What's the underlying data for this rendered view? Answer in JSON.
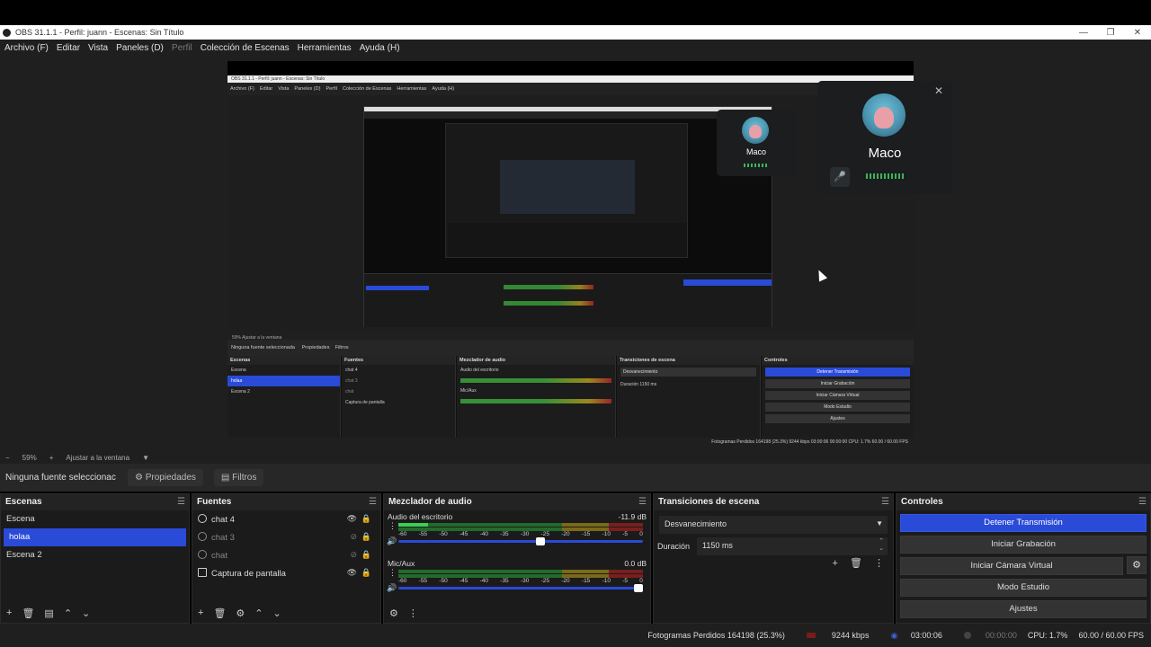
{
  "window": {
    "title": "OBS 31.1.1 - Perfil: juann - Escenas: Sin Título",
    "controls": [
      "—",
      "❐",
      "✕"
    ]
  },
  "menu": [
    {
      "label": "Archivo (F)",
      "enabled": true
    },
    {
      "label": "Editar",
      "enabled": true
    },
    {
      "label": "Vista",
      "enabled": true
    },
    {
      "label": "Paneles (D)",
      "enabled": true
    },
    {
      "label": "Perfil",
      "enabled": false
    },
    {
      "label": "Colección de Escenas",
      "enabled": true
    },
    {
      "label": "Herramientas",
      "enabled": true
    },
    {
      "label": "Ayuda (H)",
      "enabled": true
    }
  ],
  "preview": {
    "inner_menu": [
      "Archivo (F)",
      "Editar",
      "Vista",
      "Paneles (D)",
      "Perfil",
      "Colección de Escenas",
      "Herramientas",
      "Ayuda (H)"
    ],
    "inner_title": "OBS 31.1.1 - Perfil: juann - Escenas: Sin Título",
    "inner_zoom": "59%   Ajustar a la ventana",
    "inner_nosrc": "Ninguna fuente seleccionada",
    "inner_tabs": [
      "Propiedades",
      "Filtros"
    ],
    "inner_docks": {
      "scenes_title": "Escenas",
      "scenes": [
        "Escena",
        "holaa",
        "Escena 2"
      ],
      "sources_title": "Fuentes",
      "sources": [
        "chat 4",
        "chat 3",
        "chat",
        "Captura de pantalla"
      ],
      "mixer_title": "Mezclador de audio",
      "mixer": [
        "Audio del escritorio",
        "Mic/Aux"
      ],
      "transitions_title": "Transiciones de escena",
      "transition": "Desvanecimiento",
      "duration": "Duración  1150 ms",
      "controls_title": "Controles",
      "controls": [
        "Detener Transmisión",
        "Iniciar Grabación",
        "Iniciar Cámara Virtual",
        "Modo Estudio",
        "Ajustes"
      ]
    },
    "inner_footer": "Fotogramas Perdidos 164198 (25.3%)   9244 kbps   03:00:06   00:00:00   CPU: 1.7%   60.00 / 60.00 FPS",
    "call_cards": [
      {
        "name": "Maco"
      },
      {
        "name": "Maco"
      }
    ]
  },
  "zoom": {
    "minus": "−",
    "value": "59%",
    "plus": "+",
    "fit": "Ajustar a la ventana"
  },
  "source_toolbar": {
    "no_source": "Ninguna fuente seleccionac",
    "properties": "Propiedades",
    "filters": "Filtros"
  },
  "scenes": {
    "title": "Escenas",
    "items": [
      {
        "label": "Escena",
        "selected": false
      },
      {
        "label": "holaa",
        "selected": true
      },
      {
        "label": "Escena 2",
        "selected": false
      }
    ]
  },
  "sources": {
    "title": "Fuentes",
    "items": [
      {
        "label": "chat 4",
        "visible": true
      },
      {
        "label": "chat 3",
        "visible": false
      },
      {
        "label": "chat",
        "visible": false
      },
      {
        "label": "Captura de pantalla",
        "visible": true
      }
    ]
  },
  "mixer": {
    "title": "Mezclador de audio",
    "ticks": [
      "-60",
      "-55",
      "-50",
      "-45",
      "-40",
      "-35",
      "-30",
      "-25",
      "-20",
      "-15",
      "-10",
      "-5",
      "0"
    ],
    "channels": [
      {
        "name": "Audio del escritorio",
        "db": "-11.9 dB",
        "level": 0.12,
        "volume": 0.6
      },
      {
        "name": "Mic/Aux",
        "db": "0.0 dB",
        "level": 0.0,
        "volume": 1.0
      }
    ]
  },
  "transitions": {
    "title": "Transiciones de escena",
    "selected": "Desvanecimiento",
    "duration_label": "Duración",
    "duration_value": "1150 ms"
  },
  "controls": {
    "title": "Controles",
    "buttons": [
      {
        "label": "Detener Transmisión",
        "active": true
      },
      {
        "label": "Iniciar Grabación",
        "active": false
      },
      {
        "label": "Iniciar Cámara Virtual",
        "active": false
      },
      {
        "label": "Modo Estudio",
        "active": false
      },
      {
        "label": "Ajustes",
        "active": false
      }
    ]
  },
  "status": {
    "dropped": "Fotogramas Perdidos 164198 (25.3%)",
    "bitrate": "9244 kbps",
    "stream_time": "03:00:06",
    "rec_time": "00:00:00",
    "cpu": "CPU: 1.7%",
    "fps": "60.00 / 60.00 FPS"
  },
  "colors": {
    "accent": "#2a4ad8",
    "background": "#1f1f1f",
    "dock": "#1b1b1b"
  }
}
